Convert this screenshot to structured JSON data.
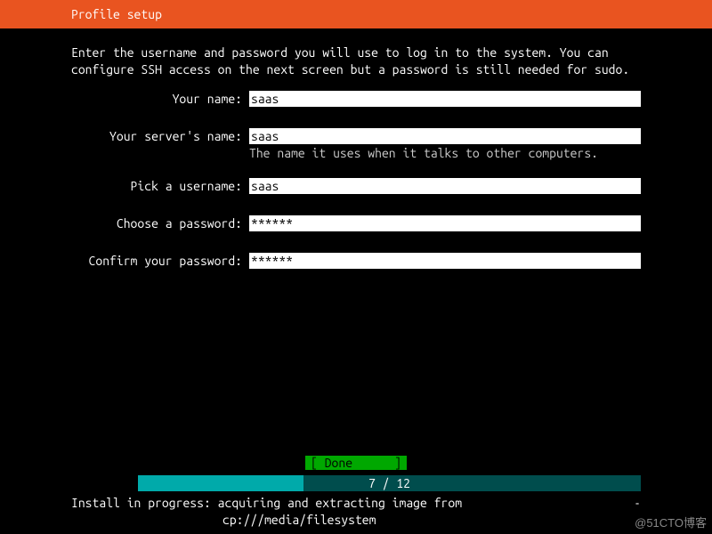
{
  "header": {
    "title": "Profile setup"
  },
  "intro": "Enter the username and password you will use to log in to the system. You can configure SSH access on the next screen but a password is still needed for sudo.",
  "fields": {
    "name": {
      "label": "Your name:",
      "value": "saas"
    },
    "server_name": {
      "label": "Your server's name:",
      "value": "saas",
      "hint": "The name it uses when it talks to other computers."
    },
    "username": {
      "label": "Pick a username:",
      "value": "saas"
    },
    "password": {
      "label": "Choose a password:",
      "value": "******"
    },
    "confirm_password": {
      "label": "Confirm your password:",
      "value": "******"
    }
  },
  "done_button": "[ Done      ]",
  "progress": {
    "text": "7 / 12",
    "percent": 33
  },
  "status": {
    "line1": "Install in progress: acquiring and extracting image from",
    "line2": "cp:///media/filesystem",
    "spinner": "-"
  },
  "watermark": "@51CTO博客"
}
